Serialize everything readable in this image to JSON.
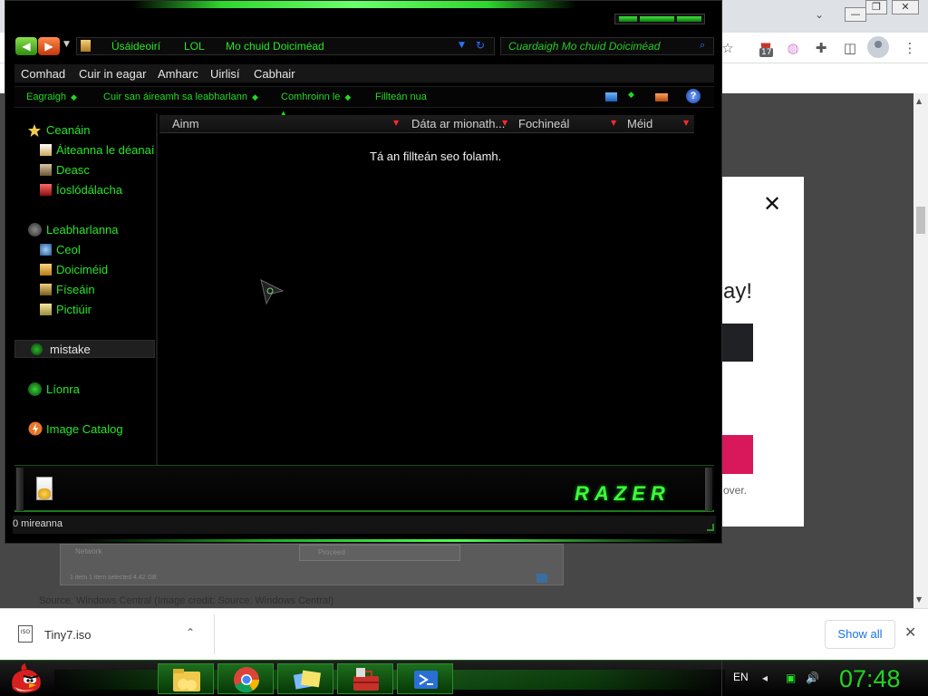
{
  "browser": {
    "window_controls": {
      "minimize": "—",
      "restore": "❐",
      "close": "✕"
    },
    "extension_badge": "17",
    "modal": {
      "close": "✕",
      "headline_fragment": "ay!",
      "footer_fragment": "over."
    },
    "article": {
      "figure_network": "Network",
      "figure_status": "1 item   1 item selected  4.42 GB",
      "figure_button": "Proceed",
      "caption": "Source: Windows Central (Image credit: Source: Windows Central)"
    },
    "download": {
      "file_icon_label": "ISO",
      "filename": "Tiny7.iso",
      "show_all": "Show all",
      "close": "✕"
    }
  },
  "explorer": {
    "nav": {
      "back": "◀",
      "forward": "▶",
      "dropdown": "▼"
    },
    "breadcrumb": [
      "Úsáideoirí",
      "LOL",
      "Mo chuid Doiciméad"
    ],
    "address_arrow": "▼",
    "refresh": "↻",
    "search_placeholder": "Cuardaigh Mo chuid Doiciméad",
    "search_icon": "⌕",
    "menu": [
      "Comhad",
      "Cuir in eagar",
      "Amharc",
      "Uirlisí",
      "Cabhair"
    ],
    "commands": [
      "Eagraigh",
      "Cuir san áireamh sa leabharlann",
      "Comhroinn le",
      "Fillteán nua"
    ],
    "command_dot": "◆",
    "help": "?",
    "favorites": {
      "title": "Ceanáin",
      "items": [
        "Áiteanna le déanaí",
        "Deasc",
        "Íoslódálacha"
      ]
    },
    "libraries": {
      "title": "Leabharlanna",
      "items": [
        "Ceol",
        "Doiciméid",
        "Físeáin",
        "Pictiúir"
      ]
    },
    "group_mistake": "mistake",
    "network": "Líonra",
    "image_catalog": "Image Catalog",
    "columns": [
      "Ainm",
      "Dáta ar mionath...",
      "Fochineál",
      "Méid"
    ],
    "sort_marker": "▲",
    "column_arrow": "▼",
    "empty_message": "Tá an fillteán seo folamh.",
    "brand_logo": "RAZER",
    "status_count": "0 mireanna"
  },
  "taskbar": {
    "tray_language": "EN",
    "tray_icons": [
      "◂",
      "▣",
      "🔊"
    ],
    "clock": "07:48"
  },
  "colors": {
    "accent_green": "#27e627",
    "taskbar_green": "#1d6e1d",
    "download_link": "#1a73e8",
    "modal_pink": "#d8185b"
  }
}
